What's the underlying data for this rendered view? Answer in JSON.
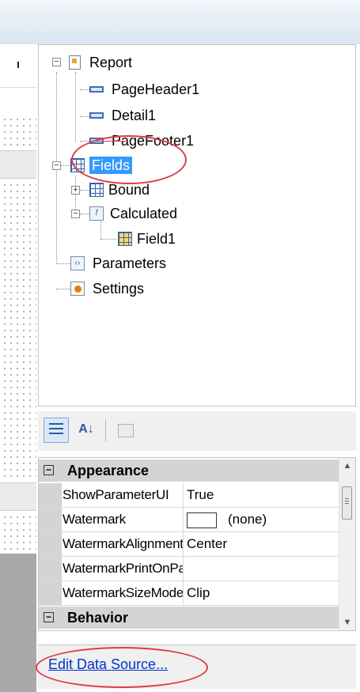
{
  "tree": {
    "items": [
      {
        "label": "Report",
        "icon": "report-icon"
      },
      {
        "label": "PageHeader1",
        "icon": "band-icon"
      },
      {
        "label": "Detail1",
        "icon": "band-icon"
      },
      {
        "label": "PageFooter1",
        "icon": "band-icon"
      },
      {
        "label": "Fields",
        "icon": "fields-icon",
        "selected": true
      },
      {
        "label": "Bound",
        "icon": "bound-fields-icon"
      },
      {
        "label": "Calculated",
        "icon": "calculated-fields-icon"
      },
      {
        "label": "Field1",
        "icon": "field-icon"
      },
      {
        "label": "Parameters",
        "icon": "parameters-icon"
      },
      {
        "label": "Settings",
        "icon": "settings-icon"
      }
    ]
  },
  "toolbar": {
    "categorized_icon": "categorized-icon",
    "alphabetical_label": "A↓",
    "alphabetical_icon": "alphabetical-sort-icon",
    "property_pages_icon": "property-pages-icon"
  },
  "property_grid": {
    "categories": [
      {
        "name": "Appearance",
        "expander": "⊟",
        "properties": [
          {
            "name": "ShowParameterUI",
            "value": "True"
          },
          {
            "name": "Watermark",
            "value": "(none)"
          },
          {
            "name": "WatermarkAlignment",
            "value": "Center"
          },
          {
            "name": "WatermarkPrintOnPages",
            "value": ""
          },
          {
            "name": "WatermarkSizeMode",
            "value": "Clip"
          }
        ]
      },
      {
        "name": "Behavior",
        "expander": "⊟"
      }
    ]
  },
  "verbs": {
    "edit_data_source": "Edit Data Source..."
  },
  "colors": {
    "selection": "#3399ff",
    "annotation_circle": "#e03a47",
    "link": "#0033cc"
  }
}
